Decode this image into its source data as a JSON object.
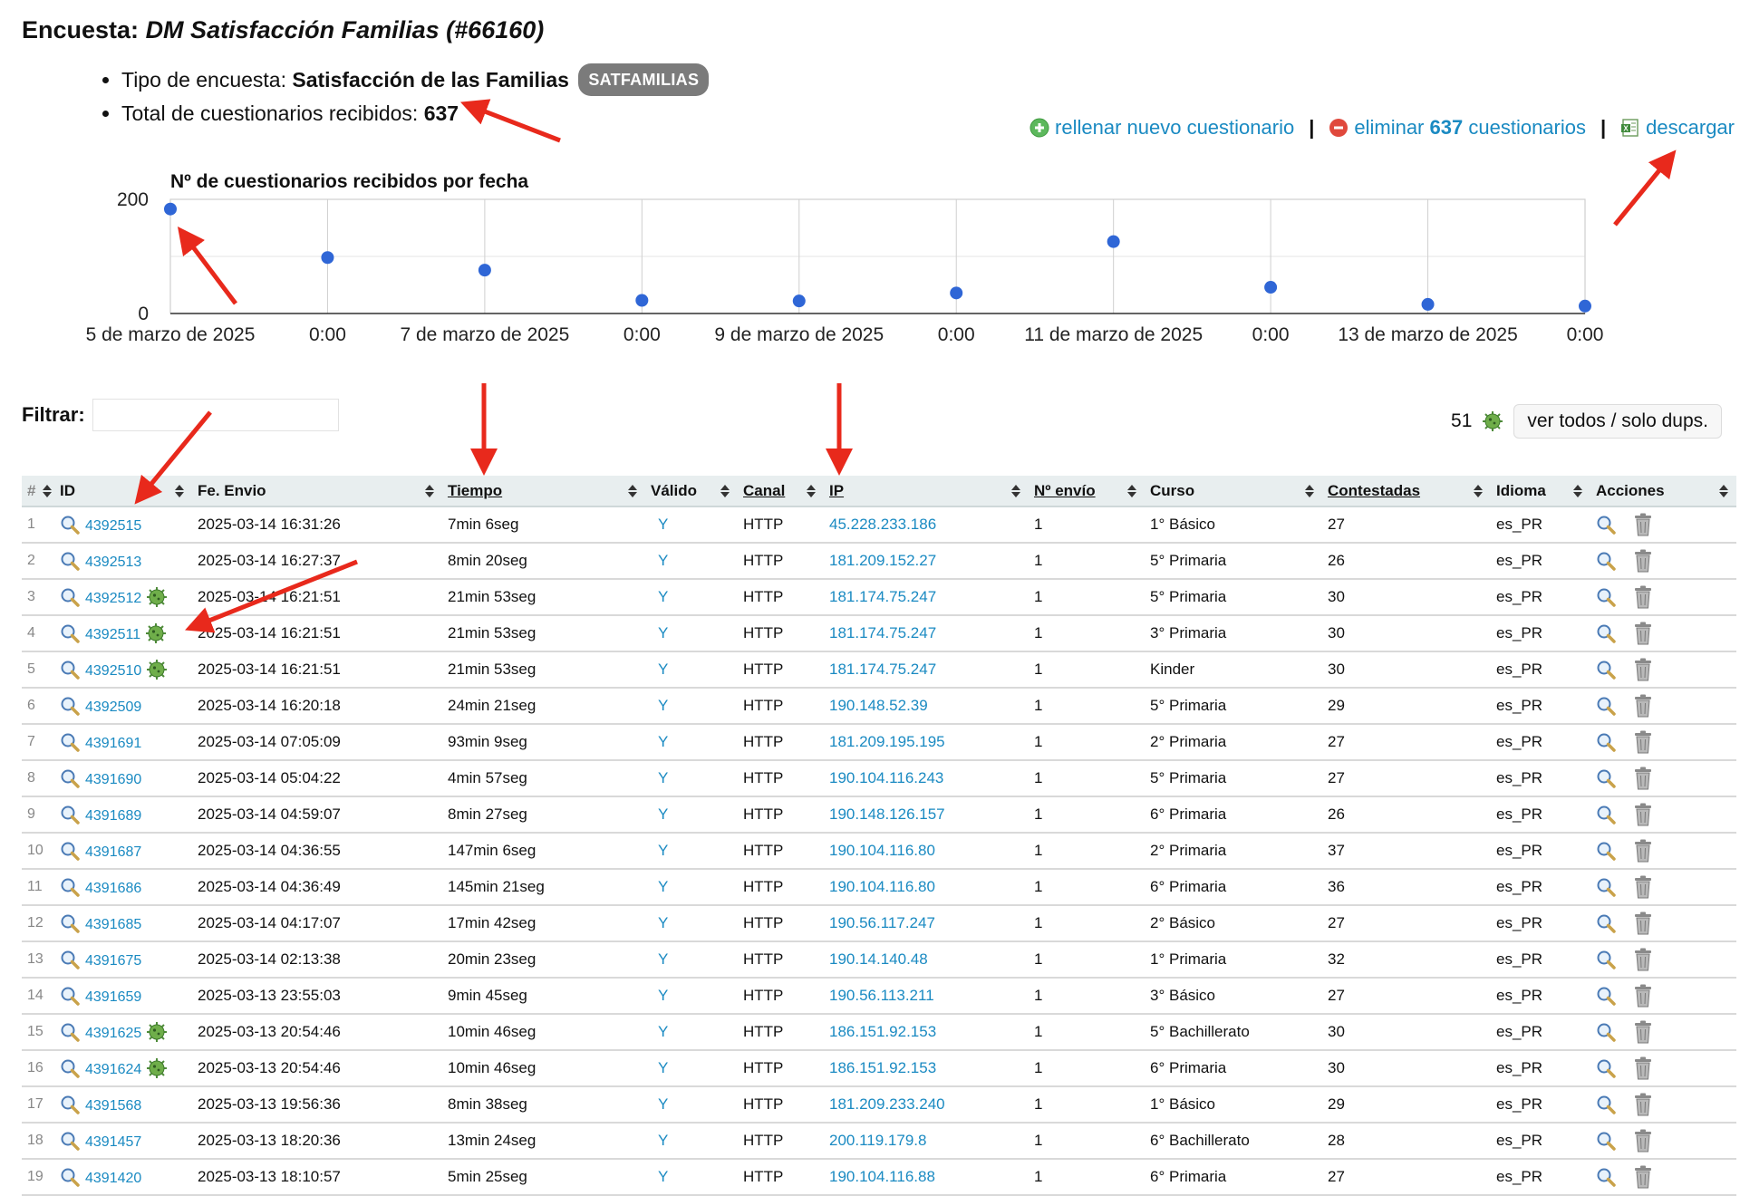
{
  "header": {
    "title_prefix": "Encuesta:",
    "title_name": "DM Satisfacción Familias (#66160)",
    "tipo_label": "Tipo de encuesta:",
    "tipo_value": "Satisfacción de las Familias",
    "tipo_badge": "SATFAMILIAS",
    "total_label": "Total de cuestionarios recibidos:",
    "total_value": "637"
  },
  "actions": {
    "new_link": "rellenar nuevo cuestionario",
    "delete_prefix": "eliminar",
    "delete_count": "637",
    "delete_suffix": "cuestionarios",
    "download": "descargar",
    "separator": "|"
  },
  "chart_data": {
    "type": "scatter",
    "title": "Nº de cuestionarios recibidos por fecha",
    "ylim": [
      0,
      200
    ],
    "y_ticks": [
      "0",
      "200"
    ],
    "x_ticks": [
      "5 de marzo de 2025",
      "0:00",
      "7 de marzo de 2025",
      "0:00",
      "9 de marzo de 2025",
      "0:00",
      "11 de marzo de 2025",
      "0:00",
      "13 de marzo de 2025",
      "0:00"
    ],
    "x": [
      "2025-03-05",
      "2025-03-06",
      "2025-03-07",
      "2025-03-08",
      "2025-03-09",
      "2025-03-10",
      "2025-03-11",
      "2025-03-12",
      "2025-03-13",
      "2025-03-14"
    ],
    "values": [
      183,
      98,
      76,
      23,
      22,
      36,
      126,
      46,
      16,
      13
    ],
    "grid": true,
    "point_color": "#2f66d6"
  },
  "filter": {
    "label": "Filtrar:",
    "value": ""
  },
  "dups": {
    "count": "51",
    "button": "ver todos / solo dups."
  },
  "table": {
    "headers": [
      "#",
      "ID",
      "Fe. Envio",
      "Tiempo",
      "Válido",
      "Canal",
      "IP",
      "Nº envío",
      "Curso",
      "Contestadas",
      "Idioma",
      "Acciones"
    ],
    "rows": [
      {
        "n": "1",
        "id": "4392515",
        "dup": false,
        "fecha": "2025-03-14 16:31:26",
        "tiempo": "7min 6seg",
        "valido": "Y",
        "canal": "HTTP",
        "ip": "45.228.233.186",
        "envio": "1",
        "curso": "1° Básico",
        "contestadas": "27",
        "idioma": "es_PR"
      },
      {
        "n": "2",
        "id": "4392513",
        "dup": false,
        "fecha": "2025-03-14 16:27:37",
        "tiempo": "8min 20seg",
        "valido": "Y",
        "canal": "HTTP",
        "ip": "181.209.152.27",
        "envio": "1",
        "curso": "5° Primaria",
        "contestadas": "26",
        "idioma": "es_PR"
      },
      {
        "n": "3",
        "id": "4392512",
        "dup": true,
        "fecha": "2025-03-14 16:21:51",
        "tiempo": "21min 53seg",
        "valido": "Y",
        "canal": "HTTP",
        "ip": "181.174.75.247",
        "envio": "1",
        "curso": "5° Primaria",
        "contestadas": "30",
        "idioma": "es_PR"
      },
      {
        "n": "4",
        "id": "4392511",
        "dup": true,
        "fecha": "2025-03-14 16:21:51",
        "tiempo": "21min 53seg",
        "valido": "Y",
        "canal": "HTTP",
        "ip": "181.174.75.247",
        "envio": "1",
        "curso": "3° Primaria",
        "contestadas": "30",
        "idioma": "es_PR"
      },
      {
        "n": "5",
        "id": "4392510",
        "dup": true,
        "fecha": "2025-03-14 16:21:51",
        "tiempo": "21min 53seg",
        "valido": "Y",
        "canal": "HTTP",
        "ip": "181.174.75.247",
        "envio": "1",
        "curso": "Kinder",
        "contestadas": "30",
        "idioma": "es_PR"
      },
      {
        "n": "6",
        "id": "4392509",
        "dup": false,
        "fecha": "2025-03-14 16:20:18",
        "tiempo": "24min 21seg",
        "valido": "Y",
        "canal": "HTTP",
        "ip": "190.148.52.39",
        "envio": "1",
        "curso": "5° Primaria",
        "contestadas": "29",
        "idioma": "es_PR"
      },
      {
        "n": "7",
        "id": "4391691",
        "dup": false,
        "fecha": "2025-03-14 07:05:09",
        "tiempo": "93min 9seg",
        "valido": "Y",
        "canal": "HTTP",
        "ip": "181.209.195.195",
        "envio": "1",
        "curso": "2° Primaria",
        "contestadas": "27",
        "idioma": "es_PR"
      },
      {
        "n": "8",
        "id": "4391690",
        "dup": false,
        "fecha": "2025-03-14 05:04:22",
        "tiempo": "4min 57seg",
        "valido": "Y",
        "canal": "HTTP",
        "ip": "190.104.116.243",
        "envio": "1",
        "curso": "5° Primaria",
        "contestadas": "27",
        "idioma": "es_PR"
      },
      {
        "n": "9",
        "id": "4391689",
        "dup": false,
        "fecha": "2025-03-14 04:59:07",
        "tiempo": "8min 27seg",
        "valido": "Y",
        "canal": "HTTP",
        "ip": "190.148.126.157",
        "envio": "1",
        "curso": "6° Primaria",
        "contestadas": "26",
        "idioma": "es_PR"
      },
      {
        "n": "10",
        "id": "4391687",
        "dup": false,
        "fecha": "2025-03-14 04:36:55",
        "tiempo": "147min 6seg",
        "valido": "Y",
        "canal": "HTTP",
        "ip": "190.104.116.80",
        "envio": "1",
        "curso": "2° Primaria",
        "contestadas": "37",
        "idioma": "es_PR"
      },
      {
        "n": "11",
        "id": "4391686",
        "dup": false,
        "fecha": "2025-03-14 04:36:49",
        "tiempo": "145min 21seg",
        "valido": "Y",
        "canal": "HTTP",
        "ip": "190.104.116.80",
        "envio": "1",
        "curso": "6° Primaria",
        "contestadas": "36",
        "idioma": "es_PR"
      },
      {
        "n": "12",
        "id": "4391685",
        "dup": false,
        "fecha": "2025-03-14 04:17:07",
        "tiempo": "17min 42seg",
        "valido": "Y",
        "canal": "HTTP",
        "ip": "190.56.117.247",
        "envio": "1",
        "curso": "2° Básico",
        "contestadas": "27",
        "idioma": "es_PR"
      },
      {
        "n": "13",
        "id": "4391675",
        "dup": false,
        "fecha": "2025-03-14 02:13:38",
        "tiempo": "20min 23seg",
        "valido": "Y",
        "canal": "HTTP",
        "ip": "190.14.140.48",
        "envio": "1",
        "curso": "1° Primaria",
        "contestadas": "32",
        "idioma": "es_PR"
      },
      {
        "n": "14",
        "id": "4391659",
        "dup": false,
        "fecha": "2025-03-13 23:55:03",
        "tiempo": "9min 45seg",
        "valido": "Y",
        "canal": "HTTP",
        "ip": "190.56.113.211",
        "envio": "1",
        "curso": "3° Básico",
        "contestadas": "27",
        "idioma": "es_PR"
      },
      {
        "n": "15",
        "id": "4391625",
        "dup": true,
        "fecha": "2025-03-13 20:54:46",
        "tiempo": "10min 46seg",
        "valido": "Y",
        "canal": "HTTP",
        "ip": "186.151.92.153",
        "envio": "1",
        "curso": "5° Bachillerato",
        "contestadas": "30",
        "idioma": "es_PR"
      },
      {
        "n": "16",
        "id": "4391624",
        "dup": true,
        "fecha": "2025-03-13 20:54:46",
        "tiempo": "10min 46seg",
        "valido": "Y",
        "canal": "HTTP",
        "ip": "186.151.92.153",
        "envio": "1",
        "curso": "6° Primaria",
        "contestadas": "30",
        "idioma": "es_PR"
      },
      {
        "n": "17",
        "id": "4391568",
        "dup": false,
        "fecha": "2025-03-13 19:56:36",
        "tiempo": "8min 38seg",
        "valido": "Y",
        "canal": "HTTP",
        "ip": "181.209.233.240",
        "envio": "1",
        "curso": "1° Básico",
        "contestadas": "29",
        "idioma": "es_PR"
      },
      {
        "n": "18",
        "id": "4391457",
        "dup": false,
        "fecha": "2025-03-13 18:20:36",
        "tiempo": "13min 24seg",
        "valido": "Y",
        "canal": "HTTP",
        "ip": "200.119.179.8",
        "envio": "1",
        "curso": "6° Bachillerato",
        "contestadas": "28",
        "idioma": "es_PR"
      },
      {
        "n": "19",
        "id": "4391420",
        "dup": false,
        "fecha": "2025-03-13 18:10:57",
        "tiempo": "5min 25seg",
        "valido": "Y",
        "canal": "HTTP",
        "ip": "190.104.116.88",
        "envio": "1",
        "curso": "6° Primaria",
        "contestadas": "27",
        "idioma": "es_PR"
      }
    ]
  },
  "colors": {
    "link": "#1a8ac2",
    "header_bg": "#e8eeef",
    "badge": "#7b7b7b",
    "annotation": "#e8291c",
    "point": "#2f66d6"
  }
}
